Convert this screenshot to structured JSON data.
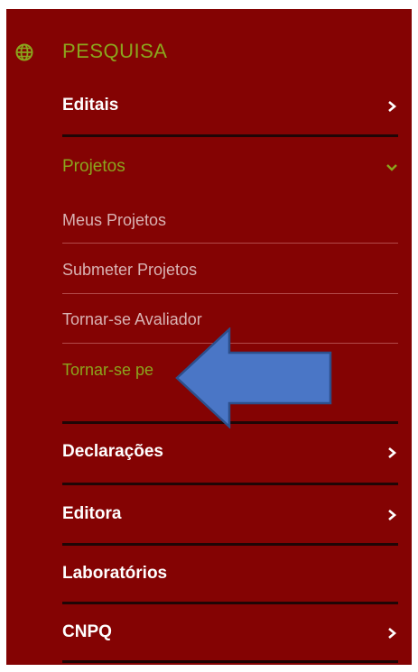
{
  "section": {
    "title": "PESQUISA",
    "icon": "globe-icon"
  },
  "menu": {
    "editais": "Editais",
    "projetos": "Projetos",
    "projetos_sub": [
      "Meus Projetos",
      "Submeter Projetos",
      "Tornar-se Avaliador",
      "Tornar-se pe"
    ],
    "declaracoes": "Declarações",
    "editora": "Editora",
    "laboratorios": "Laboratórios",
    "cnpq": "CNPQ"
  },
  "colors": {
    "panel_bg": "#840303",
    "accent_green": "#8ba51d",
    "arrow_fill": "#4a76c6",
    "arrow_stroke": "#2c4f8c"
  }
}
